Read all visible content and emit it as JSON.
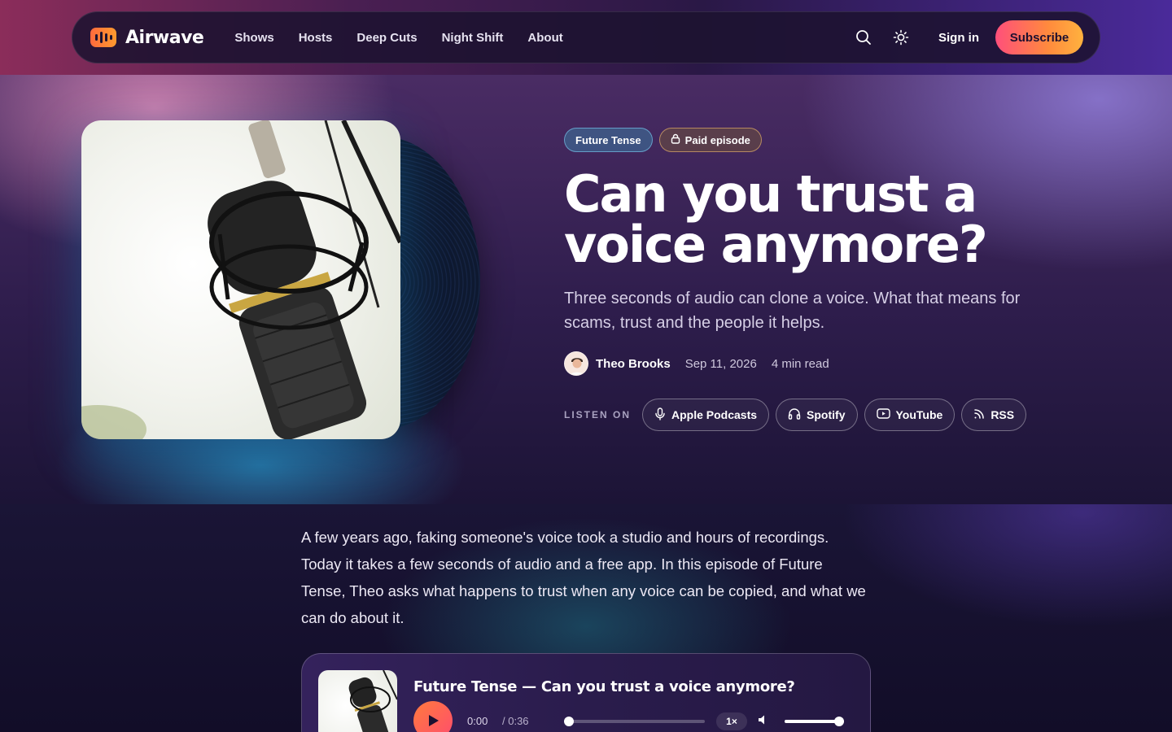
{
  "brand": {
    "name": "Airwave"
  },
  "nav": {
    "links": [
      "Shows",
      "Hosts",
      "Deep Cuts",
      "Night Shift",
      "About"
    ],
    "sign_in": "Sign in",
    "subscribe": "Subscribe"
  },
  "episode": {
    "tags": [
      "Future Tense",
      "Paid episode"
    ],
    "title_line1": "Can you trust a",
    "title_line2": "voice anymore?",
    "subtitle": "Three seconds of audio can clone a voice. What that means for scams, trust and the people it helps.",
    "author": "Theo Brooks",
    "date": "Sep 11, 2026",
    "read_time": "4 min read"
  },
  "listen_on": {
    "label": "LISTEN ON",
    "platforms": [
      {
        "label": "Apple Podcasts",
        "icon": "microphone-icon"
      },
      {
        "label": "Spotify",
        "icon": "headphones-icon"
      },
      {
        "label": "YouTube",
        "icon": "youtube-icon"
      },
      {
        "label": "RSS",
        "icon": "rss-icon"
      }
    ]
  },
  "article": {
    "intro": "A few years ago, faking someone's voice took a studio and hours of recordings. Today it takes a few seconds of audio and a free app. In this episode of Future Tense, Theo asks what happens to trust when any voice can be copied, and what we can do about it."
  },
  "player": {
    "title": "Future Tense — Can you trust a voice anymore?",
    "current_time": "0:00",
    "duration": "/ 0:36",
    "progress": 0,
    "speed": "1×",
    "volume": 1.0
  },
  "colors": {
    "accent_start": "#ff4f7b",
    "accent_end": "#ffb23e",
    "background": "#120c26"
  }
}
